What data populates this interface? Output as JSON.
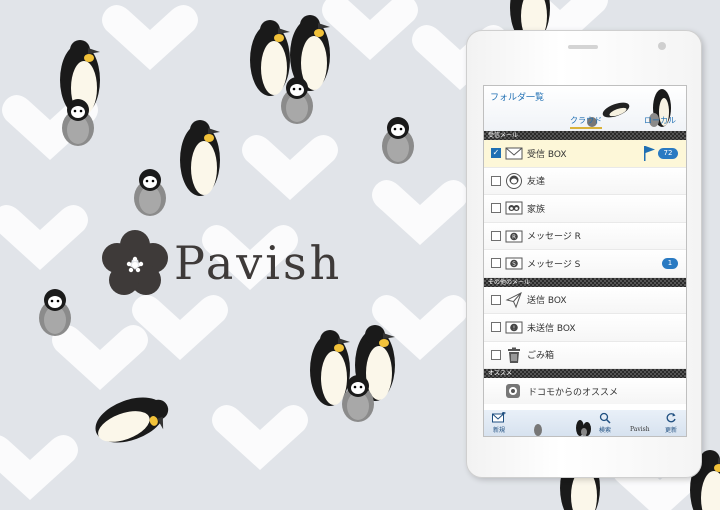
{
  "brand": {
    "name": "Pavish"
  },
  "screen": {
    "header": {
      "title": "フォルダ一覧",
      "tabs": [
        {
          "label": "クラウド"
        },
        {
          "label": "ローカル"
        }
      ]
    },
    "sections": [
      {
        "title": "受信メール",
        "items": [
          {
            "label": "受信 BOX",
            "icon": "envelope-icon",
            "checked": true,
            "badge": "72",
            "flag": true
          },
          {
            "label": "友達",
            "icon": "penguin-face-icon",
            "checked": false
          },
          {
            "label": "家族",
            "icon": "penguin-family-icon",
            "checked": false
          },
          {
            "label": "メッセージ R",
            "icon": "message-r-icon",
            "checked": false
          },
          {
            "label": "メッセージ S",
            "icon": "message-s-icon",
            "checked": false,
            "badge": "1"
          }
        ]
      },
      {
        "title": "その他のメール",
        "items": [
          {
            "label": "送信 BOX",
            "icon": "paper-plane-icon",
            "checked": false
          },
          {
            "label": "未送信 BOX",
            "icon": "draft-icon",
            "checked": false
          },
          {
            "label": "ごみ箱",
            "icon": "trash-icon",
            "checked": false
          }
        ]
      },
      {
        "title": "オススメ",
        "items": [
          {
            "label": "ドコモからのオススメ",
            "icon": "recommend-icon"
          }
        ]
      }
    ],
    "footer": {
      "new_label": "新規",
      "search_label": "検索",
      "refresh_label": "更新",
      "logo": "Pavish"
    }
  },
  "colors": {
    "accent": "#1f6fb3",
    "background": "#e1e4e9",
    "selected_row": "#fdf7d8",
    "tab_underline": "#d9b23a"
  }
}
